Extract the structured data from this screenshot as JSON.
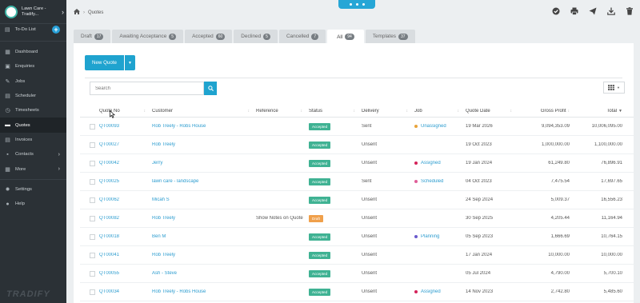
{
  "sidebar": {
    "brand_line1": "Lawn Care -",
    "brand_line2": "Tradify...",
    "todo_label": "To-Do List",
    "items": [
      {
        "label": "Dashboard",
        "icon": "dashboard-icon",
        "arrow": false
      },
      {
        "label": "Enquiries",
        "icon": "enquiries-icon",
        "arrow": false
      },
      {
        "label": "Jobs",
        "icon": "wrench-icon",
        "arrow": false
      },
      {
        "label": "Scheduler",
        "icon": "calendar-icon",
        "arrow": false
      },
      {
        "label": "Timesheets",
        "icon": "clock-icon",
        "arrow": false
      },
      {
        "label": "Quotes",
        "icon": "quotes-icon",
        "arrow": false,
        "active": true
      },
      {
        "label": "Invoices",
        "icon": "invoice-icon",
        "arrow": false
      },
      {
        "label": "Contacts",
        "icon": "contacts-icon",
        "arrow": true
      },
      {
        "label": "More",
        "icon": "more-icon",
        "arrow": true
      },
      {
        "label": "Settings",
        "icon": "gear-icon",
        "arrow": false
      },
      {
        "label": "Help",
        "icon": "help-icon",
        "arrow": false
      }
    ],
    "footer_logo": "TRADIFY"
  },
  "header": {
    "breadcrumb": "Quotes"
  },
  "tabs": [
    {
      "label": "Draft",
      "count": "17"
    },
    {
      "label": "Awaiting Acceptance",
      "count": "5"
    },
    {
      "label": "Accepted",
      "count": "60"
    },
    {
      "label": "Declined",
      "count": "5"
    },
    {
      "label": "Cancelled",
      "count": "7"
    },
    {
      "label": "All",
      "count": "94",
      "active": true
    },
    {
      "label": "Templates",
      "count": "37"
    }
  ],
  "toolbar": {
    "new_quote_label": "New Quote",
    "search_placeholder": "Search"
  },
  "table": {
    "headers": {
      "quote_no": "Quote No",
      "customer": "Customer",
      "reference": "Reference",
      "status": "Status",
      "delivery": "Delivery",
      "job": "Job",
      "quote_date": "Quote Date",
      "gross_profit": "Gross Profit",
      "total": "Total"
    },
    "rows": [
      {
        "quote_no": "QT00093",
        "customer": "Rob Treely - Robs House",
        "reference": "",
        "status": "Accepted",
        "delivery": "Sent",
        "job": "Unassigned",
        "job_color": "#e8a33b",
        "date": "19 Mar 2026",
        "gp": "9,094,353.09",
        "total": "10,006,095.00"
      },
      {
        "quote_no": "QT00027",
        "customer": "Rob Treely",
        "reference": "",
        "status": "Accepted",
        "delivery": "Unsent",
        "job": "",
        "job_color": "",
        "date": "19 Oct 2023",
        "gp": "1,000,000.00",
        "total": "1,100,000.00"
      },
      {
        "quote_no": "QT00042",
        "customer": "Jerry",
        "reference": "",
        "status": "Accepted",
        "delivery": "Unsent",
        "job": "Assigned",
        "job_color": "#d4235a",
        "date": "19 Jan 2024",
        "gp": "61,249.80",
        "total": "76,896.91"
      },
      {
        "quote_no": "QT00025",
        "customer": "lawn care - landscape",
        "reference": "",
        "status": "Accepted",
        "delivery": "Sent",
        "job": "Scheduled",
        "job_color": "#e05e98",
        "date": "04 Oct 2023",
        "gp": "7,475.54",
        "total": "17,697.65"
      },
      {
        "quote_no": "QT00062",
        "customer": "Micah S",
        "reference": "",
        "status": "Accepted",
        "delivery": "Unsent",
        "job": "",
        "job_color": "",
        "date": "24 Sep 2024",
        "gp": "5,009.37",
        "total": "16,556.23"
      },
      {
        "quote_no": "QT00082",
        "customer": "Rob Treely",
        "reference": "Show Notes on Quote",
        "status": "Draft",
        "delivery": "Unsent",
        "job": "",
        "job_color": "",
        "date": "30 Sep 2025",
        "gp": "4,205.44",
        "total": "11,164.94"
      },
      {
        "quote_no": "QT00018",
        "customer": "Ben M",
        "reference": "",
        "status": "Accepted",
        "delivery": "Unsent",
        "job": "Planning",
        "job_color": "#6a5acd",
        "date": "05 Sep 2023",
        "gp": "1,666.69",
        "total": "10,764.15"
      },
      {
        "quote_no": "QT00041",
        "customer": "Rob Treely",
        "reference": "",
        "status": "Accepted",
        "delivery": "Unsent",
        "job": "",
        "job_color": "",
        "date": "17 Jan 2024",
        "gp": "10,000.00",
        "total": "10,000.00"
      },
      {
        "quote_no": "QT00055",
        "customer": "Ash - Steve",
        "reference": "",
        "status": "Accepted",
        "delivery": "Unsent",
        "job": "",
        "job_color": "",
        "date": "05 Jul 2024",
        "gp": "4,790.00",
        "total": "5,700.10"
      },
      {
        "quote_no": "QT00034",
        "customer": "Rob Treely - Robs House",
        "reference": "",
        "status": "Accepted",
        "delivery": "Unsent",
        "job": "Assigned",
        "job_color": "#d4235a",
        "date": "14 Nov 2023",
        "gp": "2,742.80",
        "total": "5,485.60"
      }
    ]
  },
  "colors": {
    "accent": "#1fa3cf",
    "accepted": "#3fb293",
    "draft": "#f0a04b",
    "sidebar_bg": "#2b3136"
  }
}
